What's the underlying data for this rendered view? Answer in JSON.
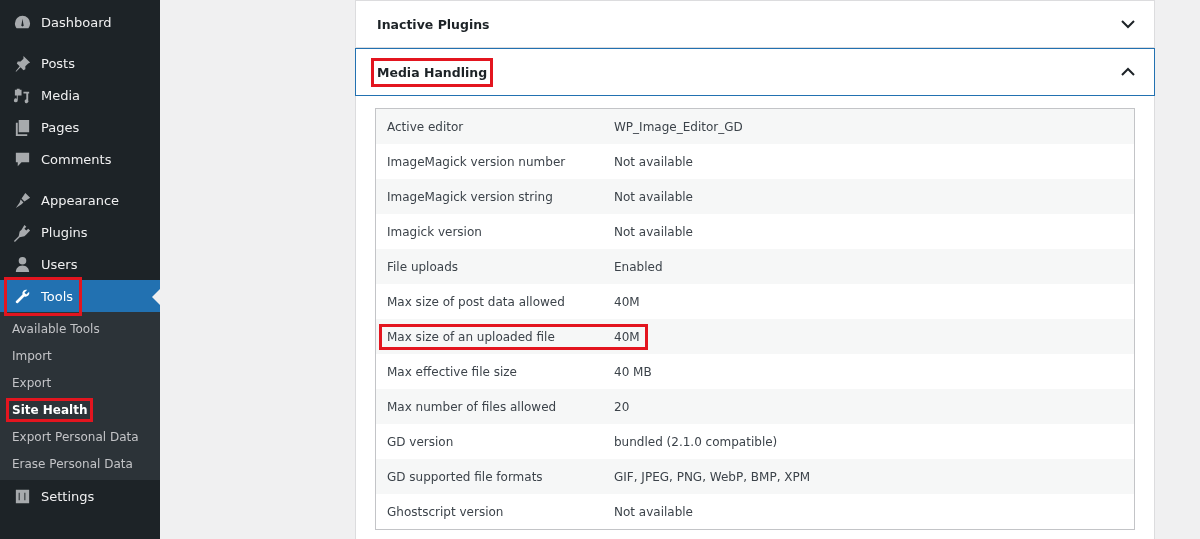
{
  "sidebar": {
    "groups": [
      {
        "items": [
          {
            "label": "Dashboard",
            "selected": false,
            "highlighted": false
          }
        ]
      },
      {
        "items": [
          {
            "label": "Posts",
            "selected": false,
            "highlighted": false
          },
          {
            "label": "Media",
            "selected": false,
            "highlighted": false
          },
          {
            "label": "Pages",
            "selected": false,
            "highlighted": false
          },
          {
            "label": "Comments",
            "selected": false,
            "highlighted": false
          }
        ]
      },
      {
        "items": [
          {
            "label": "Appearance",
            "selected": false,
            "highlighted": false
          },
          {
            "label": "Plugins",
            "selected": false,
            "highlighted": false
          },
          {
            "label": "Users",
            "selected": false,
            "highlighted": false
          },
          {
            "label": "Tools",
            "selected": true,
            "highlighted": true,
            "children": [
              {
                "label": "Available Tools",
                "selected": false,
                "highlighted": false
              },
              {
                "label": "Import",
                "selected": false,
                "highlighted": false
              },
              {
                "label": "Export",
                "selected": false,
                "highlighted": false
              },
              {
                "label": "Site Health",
                "selected": true,
                "highlighted": true
              },
              {
                "label": "Export Personal Data",
                "selected": false,
                "highlighted": false
              },
              {
                "label": "Erase Personal Data",
                "selected": false,
                "highlighted": false
              }
            ]
          },
          {
            "label": "Settings",
            "selected": false,
            "highlighted": false
          }
        ]
      }
    ]
  },
  "sections": [
    {
      "title": "Inactive Plugins",
      "expanded": false,
      "highlighted": false
    },
    {
      "title": "Media Handling",
      "expanded": true,
      "highlighted": true,
      "rows": [
        {
          "label": "Active editor",
          "value": "WP_Image_Editor_GD",
          "highlighted": false
        },
        {
          "label": "ImageMagick version number",
          "value": "Not available",
          "highlighted": false
        },
        {
          "label": "ImageMagick version string",
          "value": "Not available",
          "highlighted": false
        },
        {
          "label": "Imagick version",
          "value": "Not available",
          "highlighted": false
        },
        {
          "label": "File uploads",
          "value": "Enabled",
          "highlighted": false
        },
        {
          "label": "Max size of post data allowed",
          "value": "40M",
          "highlighted": false
        },
        {
          "label": "Max size of an uploaded file",
          "value": "40M",
          "highlighted": true
        },
        {
          "label": "Max effective file size",
          "value": "40 MB",
          "highlighted": false
        },
        {
          "label": "Max number of files allowed",
          "value": "20",
          "highlighted": false
        },
        {
          "label": "GD version",
          "value": "bundled (2.1.0 compatible)",
          "highlighted": false
        },
        {
          "label": "GD supported file formats",
          "value": "GIF, JPEG, PNG, WebP, BMP, XPM",
          "highlighted": false
        },
        {
          "label": "Ghostscript version",
          "value": "Not available",
          "highlighted": false
        }
      ]
    }
  ]
}
